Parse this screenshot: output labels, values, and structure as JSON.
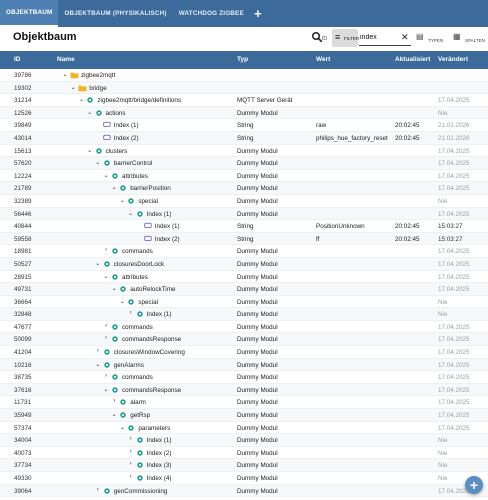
{
  "tabs": [
    {
      "label": "OBJEKTBAUM",
      "active": true
    },
    {
      "label": "OBJEKTBAUM (PHYSIKALISCH)",
      "active": false
    },
    {
      "label": "WATCHDOG ZIGBEE",
      "active": false
    }
  ],
  "tab_add": "+",
  "header": {
    "title": "Objektbaum",
    "search_sub": "ID",
    "filter_label": "FILTER",
    "filter_value": "index",
    "types_label": "TYPEN",
    "columns_label": "SPALTEN"
  },
  "columns": {
    "id": "ID",
    "name": "Name",
    "type": "Typ",
    "value": "Wert",
    "ack": "Aktualisiert",
    "changed": "Verändert"
  },
  "colors": {
    "header_bar": "#3c6b9b",
    "folder": "#f0b429",
    "device": "#2a9d8f",
    "state": "#7b68c9"
  },
  "rows": [
    {
      "id": "39786",
      "level": 0,
      "toggle": "down",
      "icon": "folder",
      "name": "zigbee2mqtt",
      "type": "",
      "value": "",
      "ack": "",
      "changed": ""
    },
    {
      "id": "19302",
      "level": 1,
      "toggle": "down",
      "icon": "folder",
      "name": "bridge",
      "type": "",
      "value": "",
      "ack": "",
      "changed": ""
    },
    {
      "id": "31214",
      "level": 2,
      "toggle": "down",
      "icon": "device",
      "name": "zigbee2mqtt/bridge/definitions",
      "type": "MQTT Server Gerät",
      "value": "",
      "ack": "",
      "changed": "17.04.2025"
    },
    {
      "id": "12526",
      "level": 3,
      "toggle": "down",
      "icon": "device",
      "name": "actions",
      "type": "Dummy Modul",
      "value": "",
      "ack": "",
      "changed": "Nie"
    },
    {
      "id": "39849",
      "level": 4,
      "toggle": "",
      "icon": "state",
      "name": "Index (1)",
      "type": "String",
      "value": "raw",
      "ack": "20:02:45",
      "changed": "21.01.2026"
    },
    {
      "id": "43014",
      "level": 4,
      "toggle": "",
      "icon": "state",
      "name": "Index (2)",
      "type": "String",
      "value": "philips_hue_factory_reset",
      "ack": "20:02:45",
      "changed": "21.01.2026"
    },
    {
      "id": "15613",
      "level": 3,
      "toggle": "down",
      "icon": "device",
      "name": "clusters",
      "type": "Dummy Modul",
      "value": "",
      "ack": "",
      "changed": "17.04.2025"
    },
    {
      "id": "57620",
      "level": 4,
      "toggle": "down",
      "icon": "device",
      "name": "barrierControl",
      "type": "Dummy Modul",
      "value": "",
      "ack": "",
      "changed": "17.04.2025"
    },
    {
      "id": "12224",
      "level": 5,
      "toggle": "down",
      "icon": "device",
      "name": "attributes",
      "type": "Dummy Modul",
      "value": "",
      "ack": "",
      "changed": "17.04.2025"
    },
    {
      "id": "21789",
      "level": 6,
      "toggle": "down",
      "icon": "device",
      "name": "barrierPosition",
      "type": "Dummy Modul",
      "value": "",
      "ack": "",
      "changed": "17.04.2025"
    },
    {
      "id": "32389",
      "level": 7,
      "toggle": "down",
      "icon": "device",
      "name": "special",
      "type": "Dummy Modul",
      "value": "",
      "ack": "",
      "changed": "Nie"
    },
    {
      "id": "56446",
      "level": 8,
      "toggle": "down",
      "icon": "device",
      "name": "Index (1)",
      "type": "Dummy Modul",
      "value": "",
      "ack": "",
      "changed": "17.04.2025"
    },
    {
      "id": "40844",
      "level": 9,
      "toggle": "",
      "icon": "state",
      "name": "Index (1)",
      "type": "String",
      "value": "PositionUnknown",
      "ack": "20:02:45",
      "changed": "15:03:27",
      "changed_dark": true
    },
    {
      "id": "59558",
      "level": 9,
      "toggle": "",
      "icon": "state",
      "name": "Index (2)",
      "type": "String",
      "value": "ff",
      "ack": "20:02:45",
      "changed": "15:03:27",
      "changed_dark": true
    },
    {
      "id": "18981",
      "level": 5,
      "toggle": "right",
      "icon": "device",
      "name": "commands",
      "type": "Dummy Modul",
      "value": "",
      "ack": "",
      "changed": "17.04.2025"
    },
    {
      "id": "50527",
      "level": 4,
      "toggle": "down",
      "icon": "device",
      "name": "closuresDoorLock",
      "type": "Dummy Modul",
      "value": "",
      "ack": "",
      "changed": "17.04.2025"
    },
    {
      "id": "28915",
      "level": 5,
      "toggle": "down",
      "icon": "device",
      "name": "attributes",
      "type": "Dummy Modul",
      "value": "",
      "ack": "",
      "changed": "17.04.2025"
    },
    {
      "id": "49731",
      "level": 6,
      "toggle": "down",
      "icon": "device",
      "name": "autoRelockTime",
      "type": "Dummy Modul",
      "value": "",
      "ack": "",
      "changed": "17.04.2025"
    },
    {
      "id": "36664",
      "level": 7,
      "toggle": "down",
      "icon": "device",
      "name": "special",
      "type": "Dummy Modul",
      "value": "",
      "ack": "",
      "changed": "Nie"
    },
    {
      "id": "32848",
      "level": 8,
      "toggle": "right",
      "icon": "device",
      "name": "Index (1)",
      "type": "Dummy Modul",
      "value": "",
      "ack": "",
      "changed": "Nie"
    },
    {
      "id": "47677",
      "level": 5,
      "toggle": "right",
      "icon": "device",
      "name": "commands",
      "type": "Dummy Modul",
      "value": "",
      "ack": "",
      "changed": "17.04.2025"
    },
    {
      "id": "50099",
      "level": 5,
      "toggle": "right",
      "icon": "device",
      "name": "commandsResponse",
      "type": "Dummy Modul",
      "value": "",
      "ack": "",
      "changed": "17.04.2025"
    },
    {
      "id": "41204",
      "level": 4,
      "toggle": "right",
      "icon": "device",
      "name": "closuresWindowCovering",
      "type": "Dummy Modul",
      "value": "",
      "ack": "",
      "changed": "17.04.2025"
    },
    {
      "id": "10216",
      "level": 4,
      "toggle": "down",
      "icon": "device",
      "name": "genAlarms",
      "type": "Dummy Modul",
      "value": "",
      "ack": "",
      "changed": "17.04.2025"
    },
    {
      "id": "38735",
      "level": 5,
      "toggle": "right",
      "icon": "device",
      "name": "commands",
      "type": "Dummy Modul",
      "value": "",
      "ack": "",
      "changed": "17.04.2025"
    },
    {
      "id": "37616",
      "level": 5,
      "toggle": "down",
      "icon": "device",
      "name": "commandsResponse",
      "type": "Dummy Modul",
      "value": "",
      "ack": "",
      "changed": "17.04.2025"
    },
    {
      "id": "11731",
      "level": 6,
      "toggle": "right",
      "icon": "device",
      "name": "alarm",
      "type": "Dummy Modul",
      "value": "",
      "ack": "",
      "changed": "17.04.2025"
    },
    {
      "id": "35949",
      "level": 6,
      "toggle": "down",
      "icon": "device",
      "name": "getRsp",
      "type": "Dummy Modul",
      "value": "",
      "ack": "",
      "changed": "17.04.2025"
    },
    {
      "id": "57374",
      "level": 7,
      "toggle": "down",
      "icon": "device",
      "name": "parameters",
      "type": "Dummy Modul",
      "value": "",
      "ack": "",
      "changed": "17.04.2025"
    },
    {
      "id": "34004",
      "level": 8,
      "toggle": "right",
      "icon": "device",
      "name": "Index (1)",
      "type": "Dummy Modul",
      "value": "",
      "ack": "",
      "changed": "Nie"
    },
    {
      "id": "40073",
      "level": 8,
      "toggle": "right",
      "icon": "device",
      "name": "Index (2)",
      "type": "Dummy Modul",
      "value": "",
      "ack": "",
      "changed": "Nie"
    },
    {
      "id": "37734",
      "level": 8,
      "toggle": "right",
      "icon": "device",
      "name": "Index (3)",
      "type": "Dummy Modul",
      "value": "",
      "ack": "",
      "changed": "Nie"
    },
    {
      "id": "49330",
      "level": 8,
      "toggle": "right",
      "icon": "device",
      "name": "Index (4)",
      "type": "Dummy Modul",
      "value": "",
      "ack": "",
      "changed": "Nie"
    },
    {
      "id": "39064",
      "level": 4,
      "toggle": "right",
      "icon": "device",
      "name": "genCommissioning",
      "type": "Dummy Modul",
      "value": "",
      "ack": "",
      "changed": "17.04.2025"
    }
  ],
  "fab": "+"
}
